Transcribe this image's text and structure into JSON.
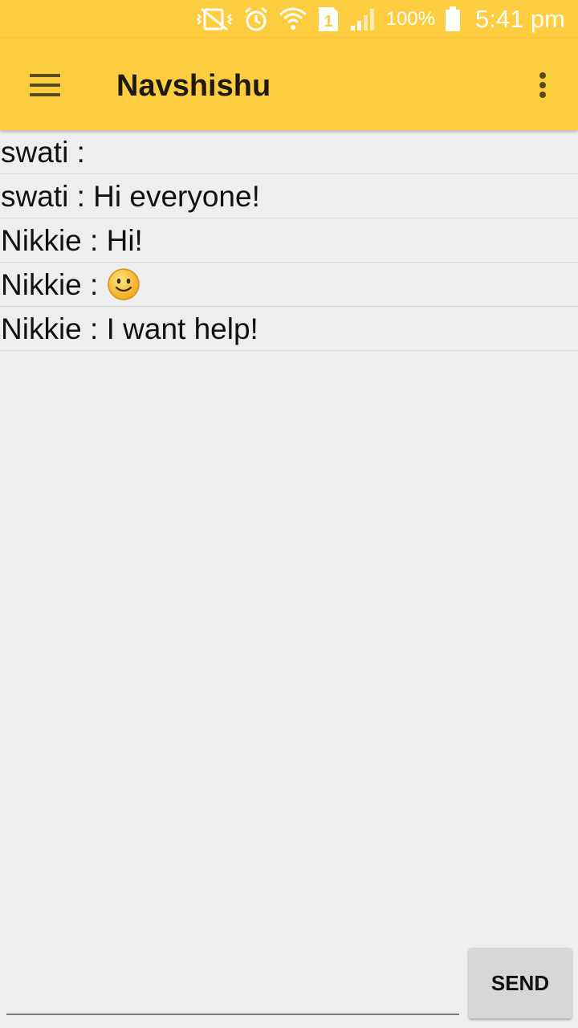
{
  "status_bar": {
    "battery_percent": "100%",
    "time": "5:41 pm",
    "sim_slot": "1",
    "icons": [
      "vibrate-off-icon",
      "alarm-icon",
      "wifi-icon",
      "sim-icon",
      "signal-icon",
      "battery-icon"
    ],
    "battery_level": 1.0
  },
  "toolbar": {
    "title": "Navshishu",
    "menu_icon": "hamburger-menu-icon",
    "overflow_icon": "more-vert-icon"
  },
  "messages": [
    {
      "sender": "swati",
      "text": ""
    },
    {
      "sender": "swati",
      "text": "Hi everyone!"
    },
    {
      "sender": "Nikkie",
      "text": "Hi!"
    },
    {
      "sender": "Nikkie",
      "text": "",
      "emoji": "smiling-face-emoji"
    },
    {
      "sender": "Nikkie",
      "text": "I want help!"
    }
  ],
  "composer": {
    "input_value": "",
    "send_label": "SEND"
  },
  "colors": {
    "accent": "#ffcd3f",
    "background": "#eeeeee",
    "send_button": "#d6d7d7"
  }
}
